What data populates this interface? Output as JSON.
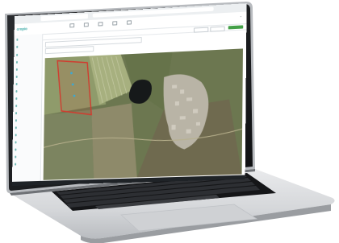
{
  "photo": {
    "subject": "laptop",
    "colors": {
      "body": "#d9dbde",
      "bezel": "#17191b",
      "keyboard": "#1c1d1f",
      "keys": "#2b2d30",
      "map_dark": "#5b6744",
      "map_light": "#98a07c",
      "field_outline": "#d23a2e",
      "pond": "#1a1e1f",
      "village": "#c9c4b8",
      "accent": "#2fa4a0"
    }
  },
  "app": {
    "logo": "cropio",
    "tab_title": "",
    "sidebar_count": 18
  }
}
